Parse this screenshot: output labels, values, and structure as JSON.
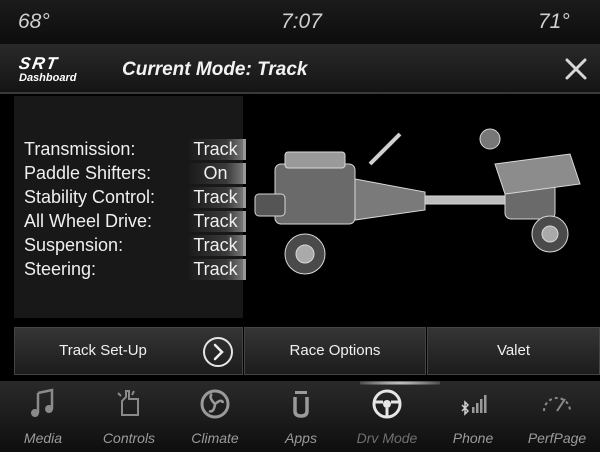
{
  "status_bar": {
    "left_temp": "68°",
    "time": "7:07",
    "right_temp": "71°"
  },
  "header": {
    "logo_text": "SRT",
    "logo_subtext": "Dashboard",
    "title": "Current Mode: Track",
    "close_icon": "close-icon"
  },
  "settings": [
    {
      "label": "Transmission:",
      "value": "Track"
    },
    {
      "label": "Paddle Shifters:",
      "value": "On"
    },
    {
      "label": "Stability Control:",
      "value": "Track"
    },
    {
      "label": "All Wheel Drive:",
      "value": "Track"
    },
    {
      "label": "Suspension:",
      "value": "Track"
    },
    {
      "label": "Steering:",
      "value": "Track"
    }
  ],
  "buttons": {
    "track_setup": "Track Set-Up",
    "race_options": "Race Options",
    "valet": "Valet"
  },
  "dock": [
    {
      "label": "Media",
      "icon": "music-note-icon"
    },
    {
      "label": "Controls",
      "icon": "controls-hand-icon"
    },
    {
      "label": "Climate",
      "icon": "climate-fan-icon"
    },
    {
      "label": "Apps",
      "icon": "apps-icon"
    },
    {
      "label": "Drv Mode",
      "icon": "steering-wheel-icon",
      "active": true
    },
    {
      "label": "Phone",
      "icon": "phone-bluetooth-signal-icon"
    },
    {
      "label": "PerfPage",
      "icon": "gauge-icon"
    }
  ],
  "colors": {
    "background": "#000000",
    "text": "#efefef",
    "dock_label": "#9b9b9b"
  }
}
